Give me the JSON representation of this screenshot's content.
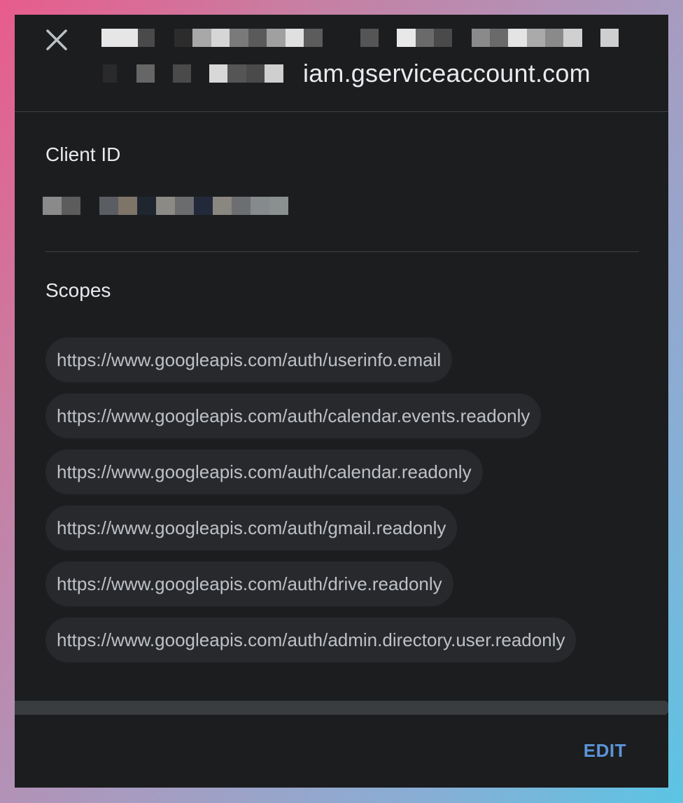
{
  "header": {
    "title_suffix": "iam.gserviceaccount.com",
    "close_icon": "close-icon"
  },
  "client_id": {
    "label": "Client ID"
  },
  "scopes": {
    "label": "Scopes",
    "items": [
      "https://www.googleapis.com/auth/userinfo.email",
      "https://www.googleapis.com/auth/calendar.events.readonly",
      "https://www.googleapis.com/auth/calendar.readonly",
      "https://www.googleapis.com/auth/gmail.readonly",
      "https://www.googleapis.com/auth/drive.readonly",
      "https://www.googleapis.com/auth/admin.directory.user.readonly"
    ]
  },
  "footer": {
    "edit_label": "EDIT"
  },
  "colors": {
    "dialog_bg": "#1c1d1f",
    "chip_bg": "#28292c",
    "chip_text": "#bdc1c6",
    "accent": "#5b95d8"
  }
}
